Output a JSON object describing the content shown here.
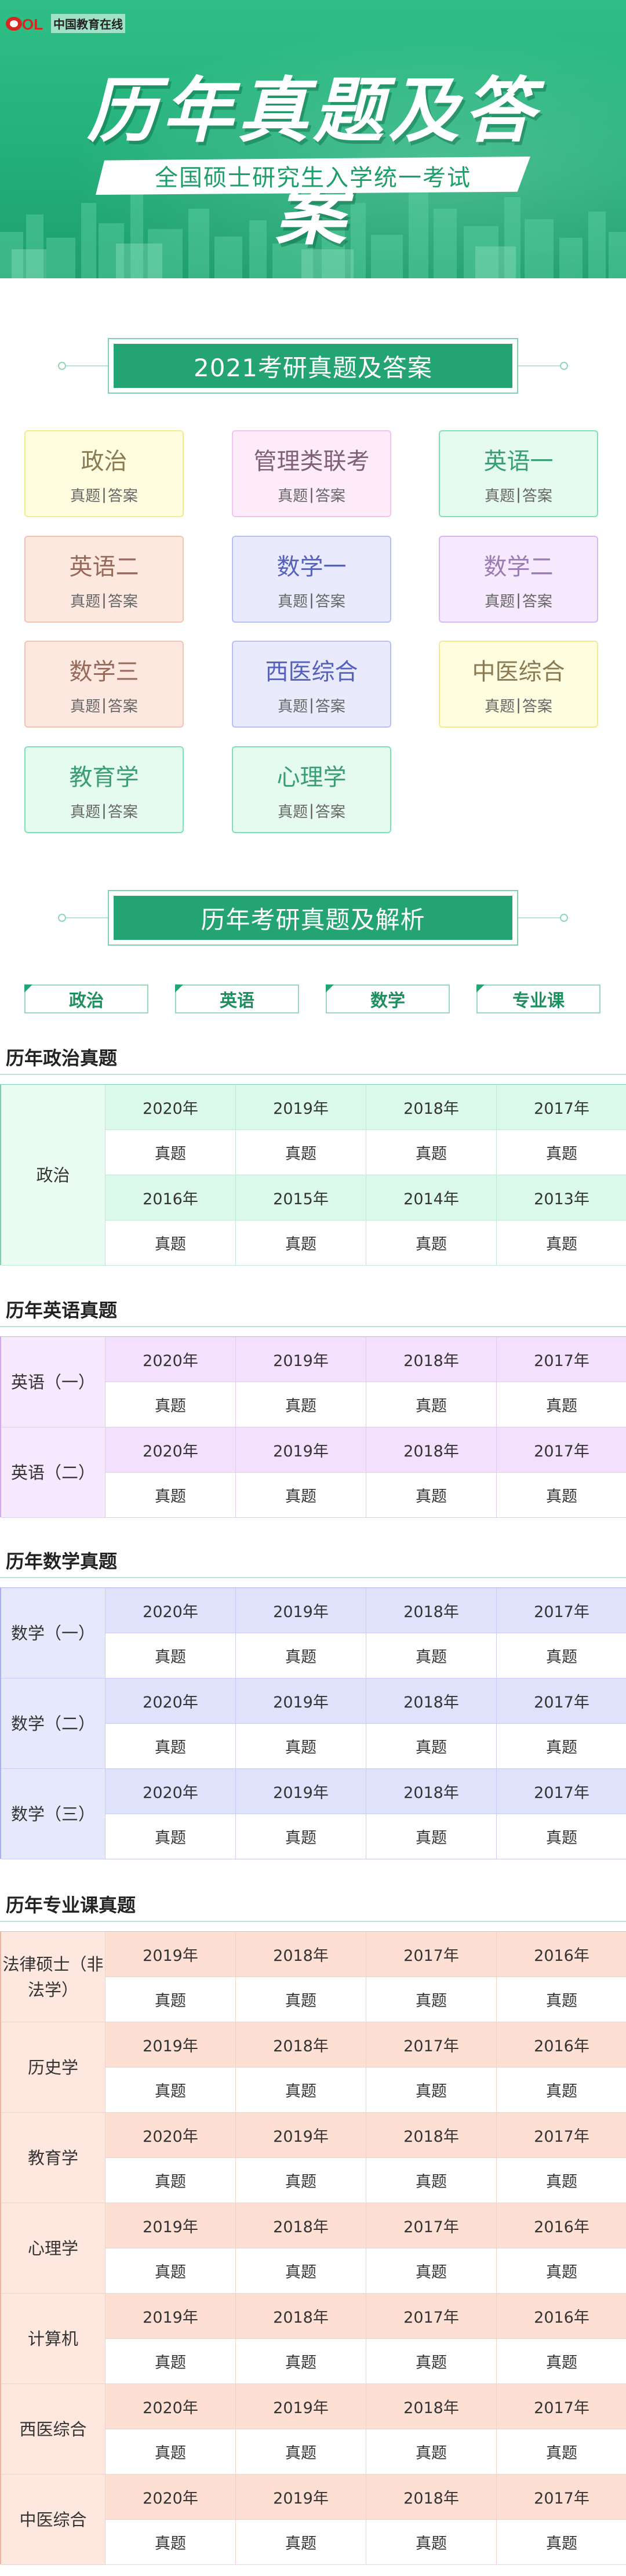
{
  "logo": {
    "text": "中国教育在线"
  },
  "banner": {
    "headline": "历年真题及答案",
    "subline": "全国硕士研究生入学统一考试"
  },
  "section1": {
    "title": "2021考研真题及答案"
  },
  "subjects": [
    {
      "name": "政治",
      "link1": "真题",
      "sep": "|",
      "link2": "答案",
      "theme": "yellow"
    },
    {
      "name": "管理类联考",
      "link1": "真题",
      "sep": "|",
      "link2": "答案",
      "theme": "pink"
    },
    {
      "name": "英语一",
      "link1": "真题",
      "sep": "|",
      "link2": "答案",
      "theme": "mint"
    },
    {
      "name": "英语二",
      "link1": "真题",
      "sep": "|",
      "link2": "答案",
      "theme": "salmon"
    },
    {
      "name": "数学一",
      "link1": "真题",
      "sep": "|",
      "link2": "答案",
      "theme": "blue"
    },
    {
      "name": "数学二",
      "link1": "真题",
      "sep": "|",
      "link2": "答案",
      "theme": "lilac"
    },
    {
      "name": "数学三",
      "link1": "真题",
      "sep": "|",
      "link2": "答案",
      "theme": "salmon"
    },
    {
      "name": "西医综合",
      "link1": "真题",
      "sep": "|",
      "link2": "答案",
      "theme": "blue"
    },
    {
      "name": "中医综合",
      "link1": "真题",
      "sep": "|",
      "link2": "答案",
      "theme": "yellow"
    },
    {
      "name": "教育学",
      "link1": "真题",
      "sep": "|",
      "link2": "答案",
      "theme": "mint"
    },
    {
      "name": "心理学",
      "link1": "真题",
      "sep": "|",
      "link2": "答案",
      "theme": "mint"
    }
  ],
  "section2": {
    "title": "历年考研真题及解析"
  },
  "tabs": [
    "政治",
    "英语",
    "数学",
    "专业课"
  ],
  "groups": [
    {
      "title": "历年政治真题",
      "theme": "green",
      "rows": [
        {
          "label": "政治",
          "blocks": [
            [
              "2020年",
              "2019年",
              "2018年",
              "2017年"
            ],
            [
              "2016年",
              "2015年",
              "2014年",
              "2013年"
            ]
          ]
        }
      ]
    },
    {
      "title": "历年英语真题",
      "theme": "purple",
      "rows": [
        {
          "label": "英语（一）",
          "blocks": [
            [
              "2020年",
              "2019年",
              "2018年",
              "2017年"
            ]
          ]
        },
        {
          "label": "英语（二）",
          "blocks": [
            [
              "2020年",
              "2019年",
              "2018年",
              "2017年"
            ]
          ]
        }
      ]
    },
    {
      "title": "历年数学真题",
      "theme": "blue",
      "rows": [
        {
          "label": "数学（一）",
          "blocks": [
            [
              "2020年",
              "2019年",
              "2018年",
              "2017年"
            ]
          ]
        },
        {
          "label": "数学（二）",
          "blocks": [
            [
              "2020年",
              "2019年",
              "2018年",
              "2017年"
            ]
          ]
        },
        {
          "label": "数学（三）",
          "blocks": [
            [
              "2020年",
              "2019年",
              "2018年",
              "2017年"
            ]
          ]
        }
      ]
    },
    {
      "title": "历年专业课真题",
      "theme": "peach",
      "rows": [
        {
          "label": "法律硕士（非法学）",
          "blocks": [
            [
              "2019年",
              "2018年",
              "2017年",
              "2016年"
            ]
          ]
        },
        {
          "label": "历史学",
          "blocks": [
            [
              "2019年",
              "2018年",
              "2017年",
              "2016年"
            ]
          ]
        },
        {
          "label": "教育学",
          "blocks": [
            [
              "2020年",
              "2019年",
              "2018年",
              "2017年"
            ]
          ]
        },
        {
          "label": "心理学",
          "blocks": [
            [
              "2019年",
              "2018年",
              "2017年",
              "2016年"
            ]
          ]
        },
        {
          "label": "计算机",
          "blocks": [
            [
              "2019年",
              "2018年",
              "2017年",
              "2016年"
            ]
          ]
        },
        {
          "label": "西医综合",
          "blocks": [
            [
              "2020年",
              "2019年",
              "2018年",
              "2017年"
            ]
          ]
        },
        {
          "label": "中医综合",
          "blocks": [
            [
              "2020年",
              "2019年",
              "2018年",
              "2017年"
            ]
          ]
        }
      ]
    }
  ],
  "cell_link_text": "真题",
  "colors": {
    "brand_green": "#23a472",
    "banner_green": "#2fbf86"
  }
}
